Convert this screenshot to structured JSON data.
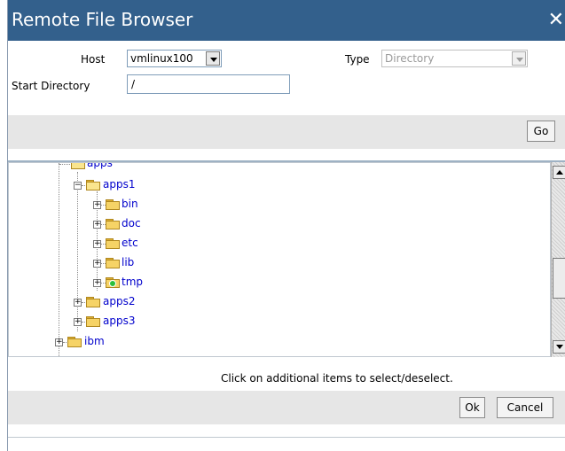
{
  "dialog": {
    "title": "Remote File Browser",
    "close_icon": "close-icon",
    "title_bar_color": "#33608c"
  },
  "form": {
    "host_label": "Host",
    "host_value": "vmlinux100",
    "type_label": "Type",
    "type_value": "Directory",
    "start_dir_label": "Start Directory",
    "start_dir_value": "/",
    "go_label": "Go"
  },
  "tree": {
    "partial_top_label": "apps",
    "nodes": [
      {
        "label": "apps1",
        "expanded": true,
        "icon": "folder-open-icon"
      },
      {
        "label": "bin",
        "expanded": false,
        "icon": "folder-icon"
      },
      {
        "label": "doc",
        "expanded": false,
        "icon": "folder-icon"
      },
      {
        "label": "etc",
        "expanded": false,
        "icon": "folder-icon"
      },
      {
        "label": "lib",
        "expanded": false,
        "icon": "folder-icon"
      },
      {
        "label": "tmp",
        "expanded": false,
        "icon": "folder-temp-icon"
      },
      {
        "label": "apps2",
        "expanded": false,
        "icon": "folder-icon"
      },
      {
        "label": "apps3",
        "expanded": false,
        "icon": "folder-icon"
      },
      {
        "label": "ibm",
        "expanded": false,
        "icon": "folder-icon"
      }
    ]
  },
  "footer": {
    "hint": "Click on additional items to select/deselect.",
    "ok_label": "Ok",
    "cancel_label": "Cancel"
  }
}
